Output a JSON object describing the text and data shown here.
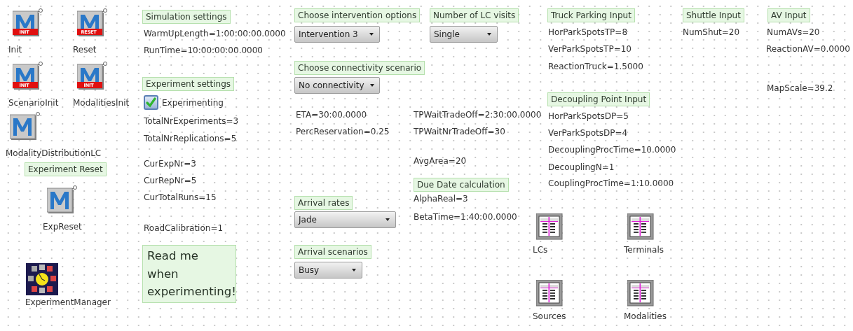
{
  "frame": {
    "objects": [
      {
        "kind": "method",
        "label": "Init",
        "badge": "INIT"
      },
      {
        "kind": "method",
        "label": "Reset",
        "badge": "RESET"
      },
      {
        "kind": "method",
        "label": "ScenarioInit",
        "badge": "INIT"
      },
      {
        "kind": "method",
        "label": "ModalitiesInit",
        "badge": "INIT"
      },
      {
        "kind": "method",
        "label": "ModalityDistributionLC"
      },
      {
        "kind": "comment",
        "text": "Experiment Reset"
      },
      {
        "kind": "method",
        "label": "ExpReset"
      },
      {
        "kind": "experiment_manager",
        "label": "ExperimentManager"
      },
      {
        "kind": "comment",
        "text": "Simulation settings"
      },
      {
        "kind": "variable",
        "text": "WarmUpLength=1:00:00:00.0000"
      },
      {
        "kind": "variable",
        "text": "RunTime=10:00:00:00.0000"
      },
      {
        "kind": "comment",
        "text": "Experiment settings"
      },
      {
        "kind": "checkbox",
        "label": "Experimenting",
        "checked": true
      },
      {
        "kind": "variable",
        "text": "TotalNrExperiments=3"
      },
      {
        "kind": "variable",
        "text": "TotalNrReplications=5"
      },
      {
        "kind": "variable",
        "text": "CurExpNr=3"
      },
      {
        "kind": "variable",
        "text": "CurRepNr=5"
      },
      {
        "kind": "variable",
        "text": "CurTotalRuns=15"
      },
      {
        "kind": "variable",
        "text": "RoadCalibration=1"
      },
      {
        "kind": "note",
        "text": "Read me when experimenting!"
      },
      {
        "kind": "comment",
        "text": "Choose intervention options"
      },
      {
        "kind": "dropdown",
        "value": "Intervention 3"
      },
      {
        "kind": "comment",
        "text": "Number of LC visits"
      },
      {
        "kind": "dropdown",
        "value": "Single"
      },
      {
        "kind": "comment",
        "text": "Choose connectivity scenario"
      },
      {
        "kind": "dropdown",
        "value": "No connectivity"
      },
      {
        "kind": "variable",
        "text": "ETA=30:00.0000"
      },
      {
        "kind": "variable",
        "text": "PercReservation=0.25"
      },
      {
        "kind": "variable",
        "text": "TPWaitTradeOff=2:30:00.0000"
      },
      {
        "kind": "variable",
        "text": "TPWaitNrTradeOff=30"
      },
      {
        "kind": "variable",
        "text": "AvgArea=20"
      },
      {
        "kind": "comment",
        "text": "Due Date calculation"
      },
      {
        "kind": "variable",
        "text": "AlphaReal=3"
      },
      {
        "kind": "variable",
        "text": "BetaTime=1:40:00.0000"
      },
      {
        "kind": "comment",
        "text": "Arrival rates"
      },
      {
        "kind": "dropdown",
        "value": "Jade"
      },
      {
        "kind": "comment",
        "text": "Arrival scenarios"
      },
      {
        "kind": "dropdown",
        "value": "Busy"
      },
      {
        "kind": "comment",
        "text": "Truck Parking Input"
      },
      {
        "kind": "variable",
        "text": "HorParkSpotsTP=8"
      },
      {
        "kind": "variable",
        "text": "VerParkSpotsTP=10"
      },
      {
        "kind": "variable",
        "text": "ReactionTruck=1.5000"
      },
      {
        "kind": "comment",
        "text": "Decoupling Point Input"
      },
      {
        "kind": "variable",
        "text": "HorParkSpotsDP=5"
      },
      {
        "kind": "variable",
        "text": "VerParkSpotsDP=4"
      },
      {
        "kind": "variable",
        "text": "DecouplingProcTime=10.0000"
      },
      {
        "kind": "variable",
        "text": "DecouplingN=1"
      },
      {
        "kind": "variable",
        "text": "CouplingProcTime=1:10.0000"
      },
      {
        "kind": "comment",
        "text": "Shuttle Input"
      },
      {
        "kind": "variable",
        "text": "NumShut=20"
      },
      {
        "kind": "comment",
        "text": "AV Input"
      },
      {
        "kind": "variable",
        "text": "NumAVs=20"
      },
      {
        "kind": "variable",
        "text": "ReactionAV=0.0000"
      },
      {
        "kind": "variable",
        "text": "MapScale=39.2"
      },
      {
        "kind": "table",
        "label": "LCs"
      },
      {
        "kind": "table",
        "label": "Terminals"
      },
      {
        "kind": "table",
        "label": "Sources"
      },
      {
        "kind": "table",
        "label": "Modalities"
      }
    ]
  }
}
